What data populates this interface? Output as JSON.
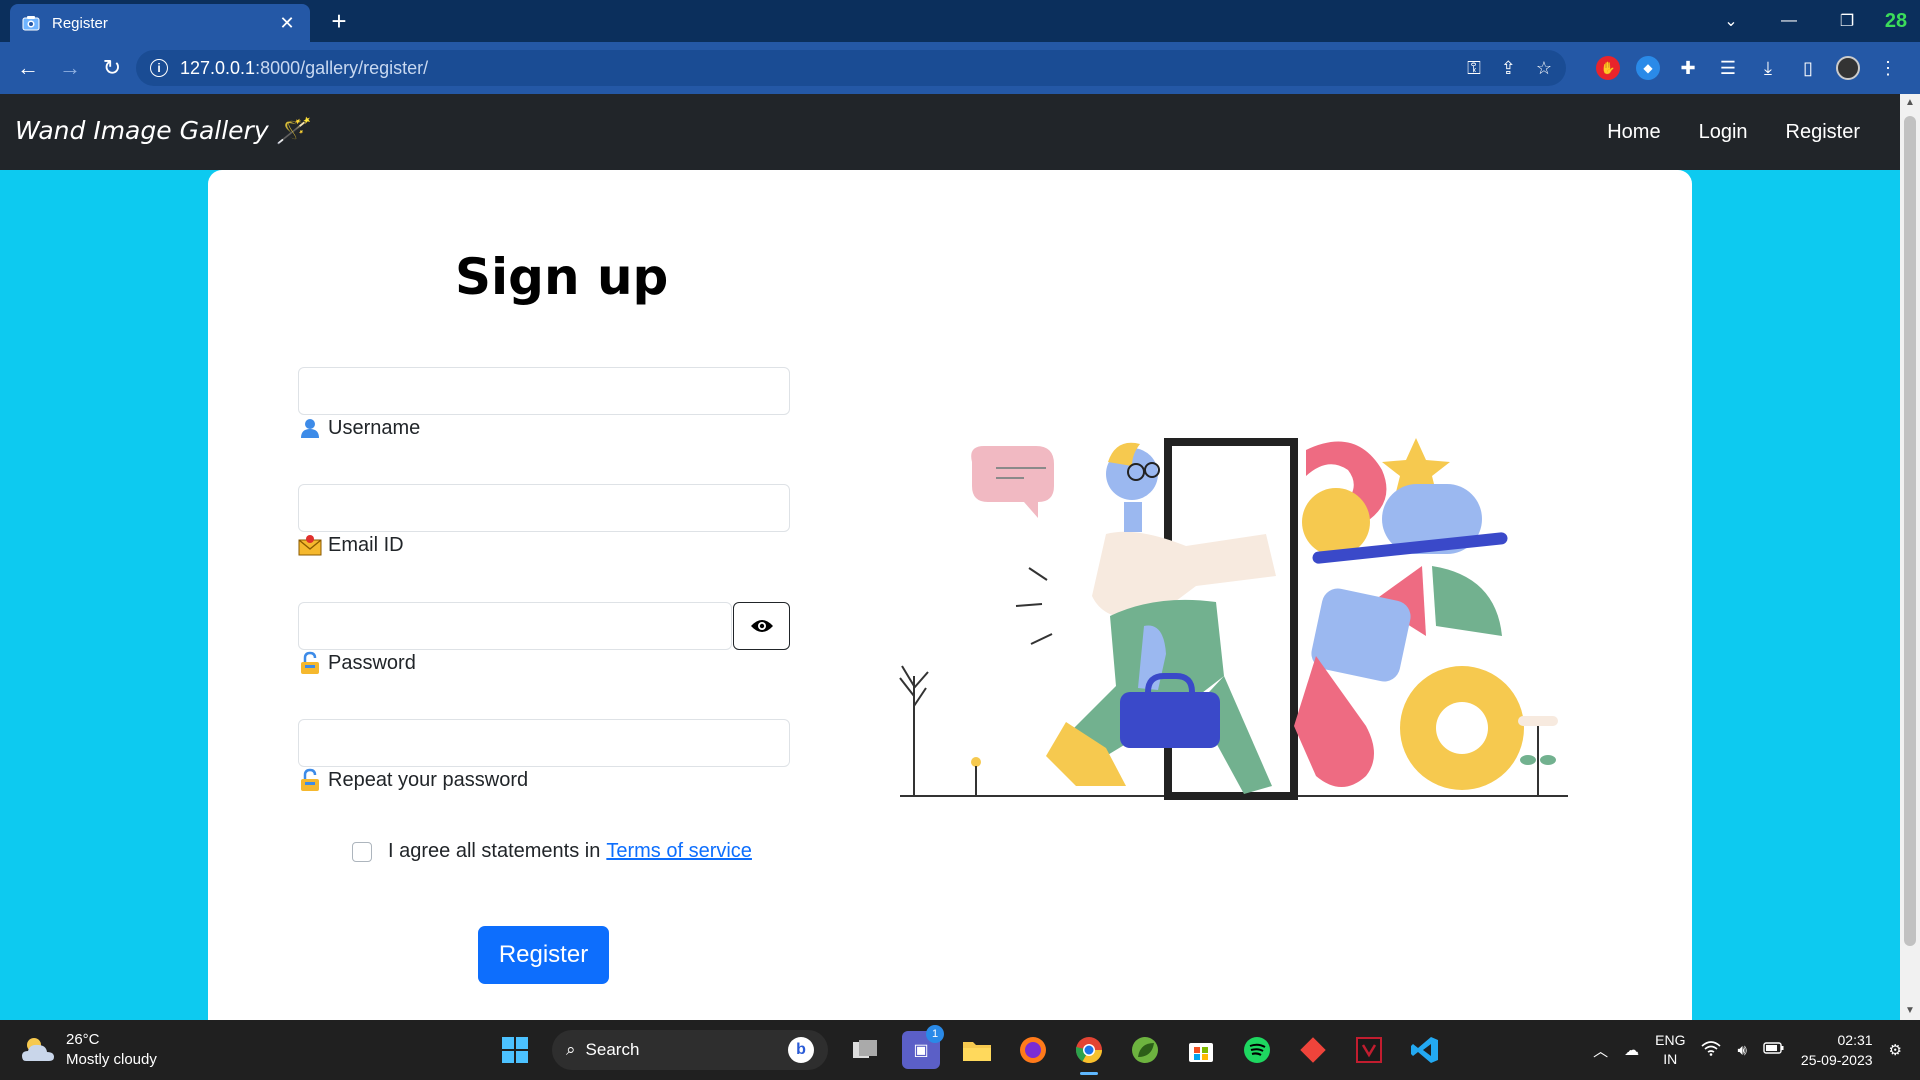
{
  "browser": {
    "tab_title": "Register",
    "new_tab": "+",
    "close": "✕",
    "url_host": "127.0.0.1",
    "url_rest": ":8000/gallery/register/",
    "window_badge": "28"
  },
  "navbar": {
    "brand": "Wand Image Gallery 🪄",
    "links": [
      "Home",
      "Login",
      "Register"
    ]
  },
  "form": {
    "title": "Sign up",
    "username_label": "Username",
    "email_label": "Email ID",
    "password_label": "Password",
    "repeat_password_label": "Repeat your password",
    "agree_text": "I agree all statements in",
    "terms_link": "Terms of service",
    "submit_label": "Register"
  },
  "taskbar": {
    "weather_temp": "26°C",
    "weather_desc": "Mostly cloudy",
    "search_placeholder": "Search",
    "chat_badge": "1",
    "lang_1": "ENG",
    "lang_2": "IN",
    "time": "02:31",
    "date": "25-09-2023"
  },
  "colors": {
    "page_bg": "#0dcaf0",
    "navbar_bg": "#212529",
    "primary": "#0d6efd",
    "browser_chrome": "#2458a6"
  }
}
